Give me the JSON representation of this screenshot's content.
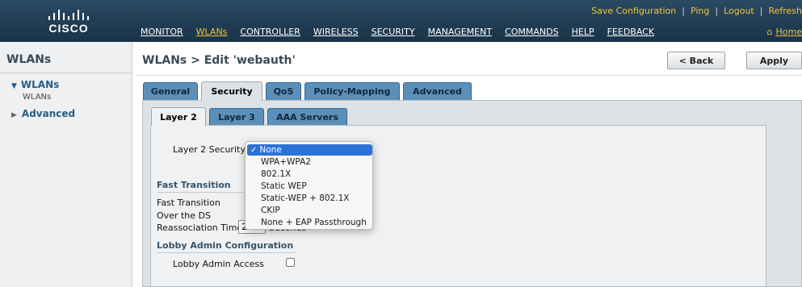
{
  "header": {
    "logo_text": "CISCO",
    "utility_links": [
      "Save Configuration",
      "Ping",
      "Logout",
      "Refresh"
    ],
    "nav": [
      {
        "label": "MONITOR",
        "active": false
      },
      {
        "label": "WLANs",
        "active": true
      },
      {
        "label": "CONTROLLER",
        "active": false
      },
      {
        "label": "WIRELESS",
        "active": false
      },
      {
        "label": "SECURITY",
        "active": false
      },
      {
        "label": "MANAGEMENT",
        "active": false
      },
      {
        "label": "COMMANDS",
        "active": false
      },
      {
        "label": "HELP",
        "active": false
      },
      {
        "label": "FEEDBACK",
        "active": false
      }
    ],
    "home_label": "Home",
    "colors": {
      "bar": "#1f3b52",
      "accent": "#f2c33b"
    }
  },
  "sidebar": {
    "title": "WLANs",
    "section": "WLANs",
    "sub_item": "WLANs",
    "advanced": "Advanced"
  },
  "page": {
    "title": "WLANs > Edit  'webauth'",
    "back_label": "< Back",
    "apply_label": "Apply"
  },
  "tabs": [
    "General",
    "Security",
    "QoS",
    "Policy-Mapping",
    "Advanced"
  ],
  "active_tab": "Security",
  "subtabs": [
    "Layer 2",
    "Layer 3",
    "AAA Servers"
  ],
  "active_subtab": "Layer 2",
  "form": {
    "layer2_security_label": "Layer 2 Security",
    "layer2_security_value": "None",
    "fast_transition_heading": "Fast Transition",
    "fast_transition_label": "Fast Transition",
    "over_ds_label": "Over the DS",
    "reassoc_label": "Reassociation Timeout",
    "reassoc_value": "20",
    "reassoc_unit": "Seconds",
    "lobby_heading": "Lobby Admin Configuration",
    "lobby_access_label": "Lobby Admin Access",
    "lobby_access_checked": false
  },
  "dropdown": {
    "open": true,
    "selected": "None",
    "options": [
      "None",
      "WPA+WPA2",
      "802.1X",
      "Static WEP",
      "Static-WEP + 802.1X",
      "CKIP",
      "None + EAP Passthrough"
    ]
  }
}
